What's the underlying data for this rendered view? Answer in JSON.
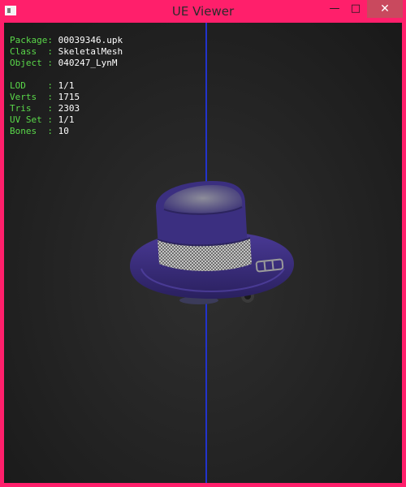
{
  "window": {
    "title": "UE Viewer",
    "controls": {
      "minimize": "—",
      "maximize": "□",
      "close": "✕"
    }
  },
  "info": {
    "rows": [
      {
        "key": "Package:",
        "value": "00039346.upk"
      },
      {
        "key": "Class  :",
        "value": "SkeletalMesh"
      },
      {
        "key": "Object :",
        "value": "040247_LynM"
      },
      {
        "key": "LOD    :",
        "value": "1/1"
      },
      {
        "key": "Verts  :",
        "value": "1715"
      },
      {
        "key": "Tris   :",
        "value": "2303"
      },
      {
        "key": "UV Set :",
        "value": "1/1"
      },
      {
        "key": "Bones  :",
        "value": "10"
      }
    ]
  },
  "colors": {
    "frame": "#ff1f6b",
    "close_button": "#c9495e",
    "viewport_bg": "#232323",
    "axis": "#2233cc",
    "label_green": "#5ad84a",
    "value_white": "#ffffff",
    "hat_purple": "#3d2f82",
    "hat_band": "#9a9a9a"
  },
  "model": {
    "icon": "fedora-hat-icon"
  }
}
